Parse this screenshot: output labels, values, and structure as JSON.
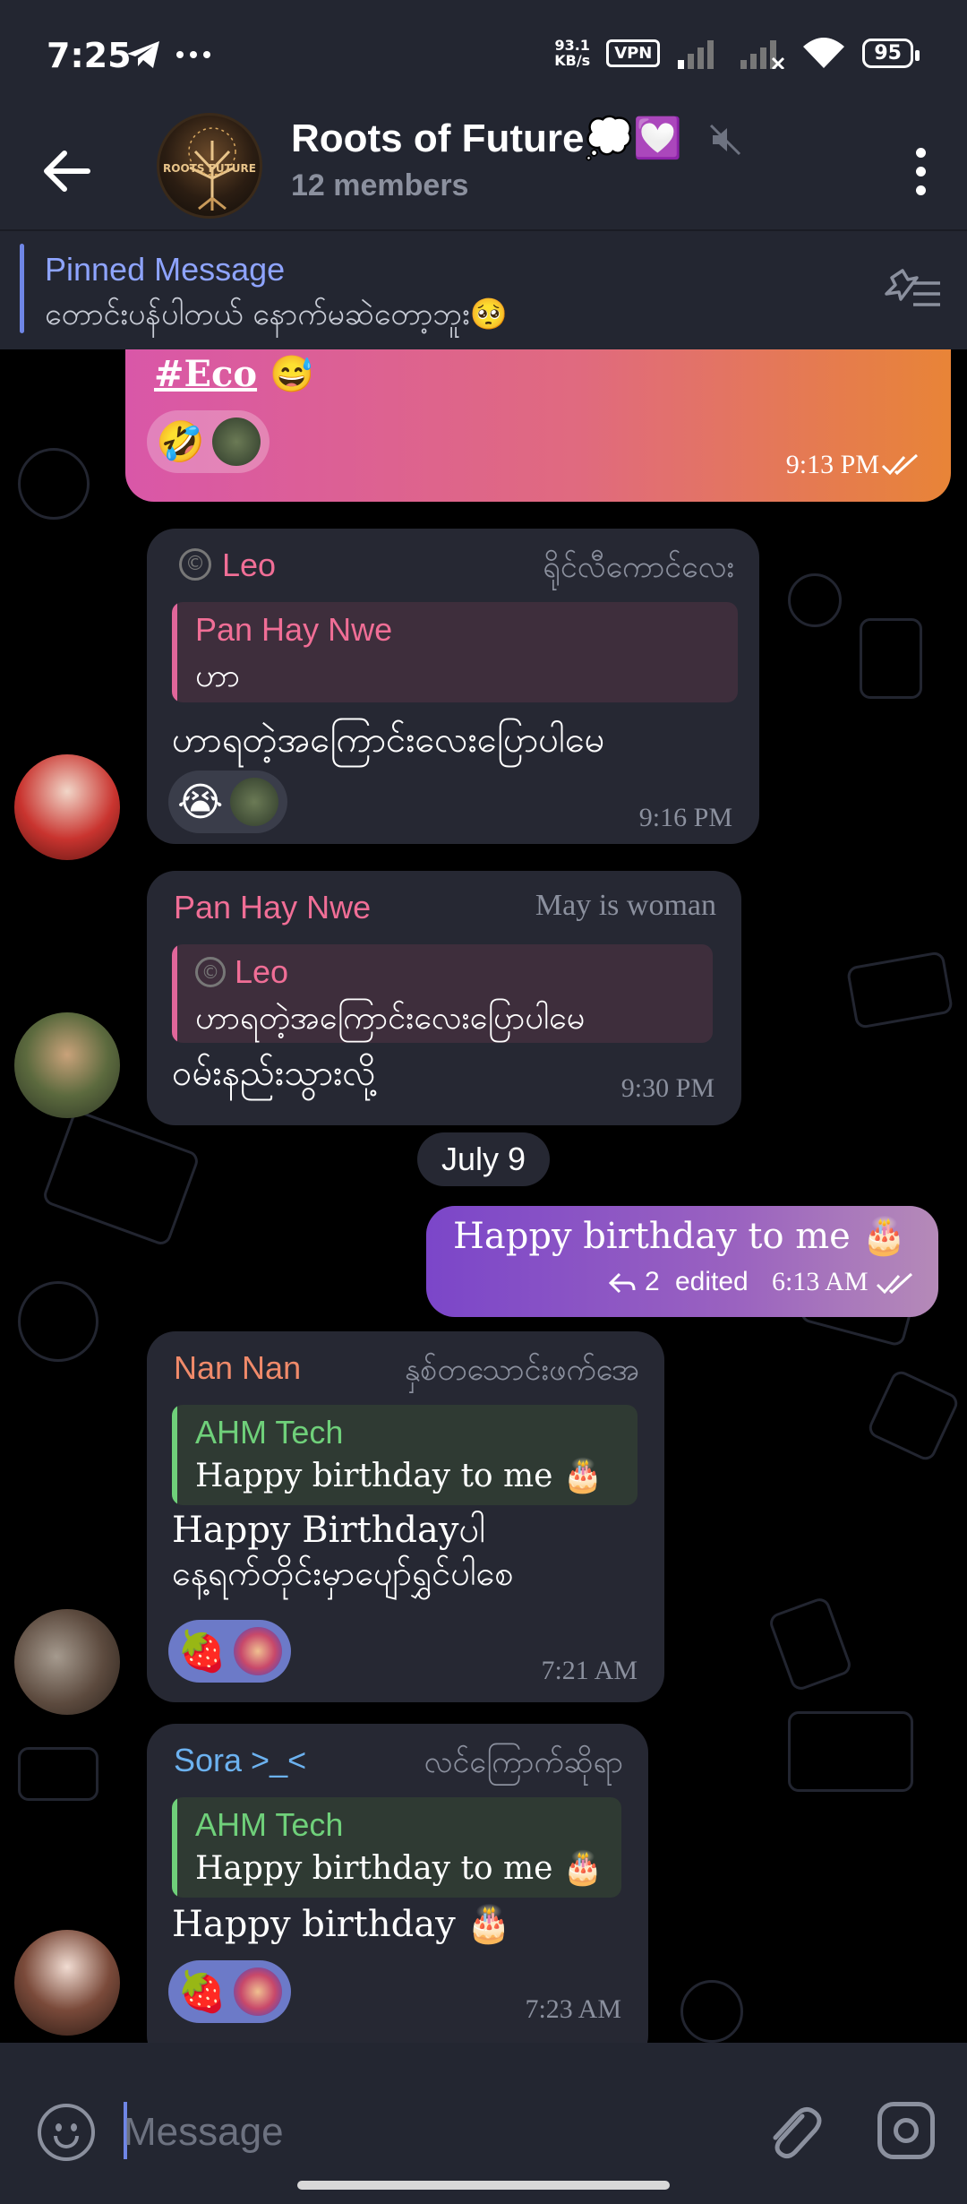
{
  "status": {
    "time": "7:25",
    "net_speed_value": "93.1",
    "net_speed_unit": "KB/s",
    "vpn": "VPN",
    "battery": "95"
  },
  "header": {
    "title": "Roots of Future💭💟",
    "subtitle": "12 members",
    "avatar_text": "ROOTS FUTURE"
  },
  "pinned": {
    "title": "Pinned Message",
    "text": "တောင်းပန်ပါတယ် နောက်မဆဲတော့ဘူး🥺"
  },
  "messages": {
    "m0": {
      "text_cut": "",
      "hashtag": "#Eco",
      "emoji": "😅",
      "reaction_emoji": "🤣",
      "time": "9:13 PM"
    },
    "m1": {
      "sender": "Leo",
      "badge": "©",
      "tag": "ရိုင်လီကောင်လေး",
      "reply_name": "Pan Hay Nwe",
      "reply_text": "ဟာ",
      "text": "ဟာရတဲ့အကြောင်းလေးပြောပါမေ",
      "reaction_emoji": "😭",
      "time": "9:16 PM"
    },
    "m2": {
      "sender": "Pan Hay Nwe",
      "tag": "May is woman",
      "reply_badge": "©",
      "reply_name": "Leo",
      "reply_text": "ဟာရတဲ့အကြောင်းလေးပြောပါမေ",
      "text": "ဝမ်းနည်းသွားလို့",
      "time": "9:30 PM"
    },
    "date_separator": "July 9",
    "m3": {
      "text": "Happy birthday  to me 🎂",
      "reply_count": "2",
      "edited": "edited",
      "time": "6:13 AM"
    },
    "m4": {
      "sender": "Nan Nan",
      "tag": "နှစ်တသောင်းဖက်အေ",
      "reply_name": "AHM Tech",
      "reply_text": "Happy birthday  to me 🎂",
      "text_line1": "Happy Birthdayပါ",
      "text_line2": "နေ့ရက်တိုင်းမှာပျော်ရွှင်ပါစေ",
      "reaction_emoji": "🍓",
      "time": "7:21 AM"
    },
    "m5": {
      "sender": "Sora >_<",
      "tag": "လင်ကြောက်ဆိုရာ",
      "reply_name": "AHM Tech",
      "reply_text": "Happy birthday  to me 🎂",
      "text": "Happy birthday 🎂",
      "reaction_emoji": "🍓",
      "time": "7:23 AM"
    }
  },
  "input": {
    "placeholder": "Message"
  },
  "colors": {
    "bar_bg": "#232631",
    "bubble_in": "#262833",
    "accent_blue": "#8ea4ff",
    "name_pink": "#e0669a",
    "name_orange": "#f08a6a",
    "name_green": "#6fd07a",
    "name_blue": "#6cb2f0",
    "outgoing_gradient_start": "#7b46c9",
    "outgoing_gradient_end": "#b58ab8"
  },
  "icons": {
    "back": "arrow-left-icon",
    "telegram": "telegram-plane-icon",
    "more": "dots-vertical-icon",
    "signal": "signal-bars-icon",
    "wifi": "wifi-icon",
    "mute": "muted-speaker-icon",
    "unpin": "pin-list-icon",
    "emoji": "smiley-icon",
    "attach": "paperclip-icon",
    "camera": "instagram-camera-icon",
    "read": "double-check-icon",
    "reply_arrow": "reply-arrow-icon"
  }
}
